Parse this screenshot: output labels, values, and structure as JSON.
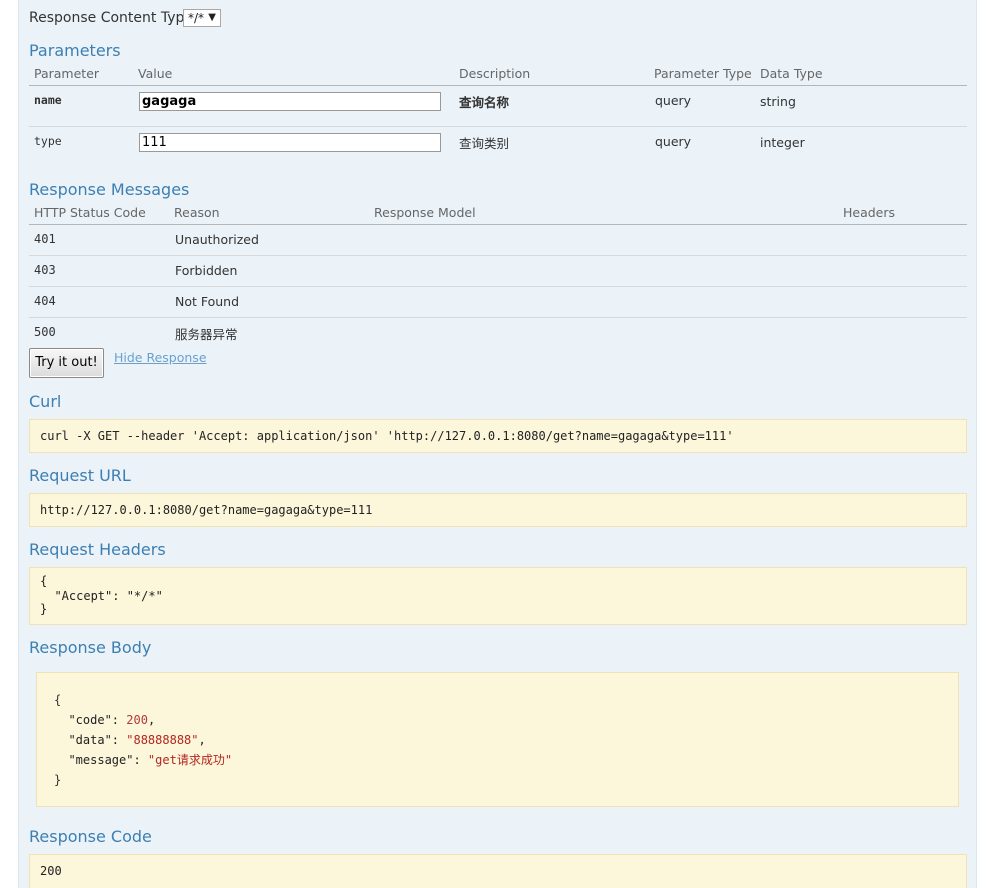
{
  "content_type": {
    "label": "Response Content Type",
    "selected": "*/*"
  },
  "parameters": {
    "title": "Parameters",
    "headers": [
      "Parameter",
      "Value",
      "Description",
      "Parameter Type",
      "Data Type"
    ],
    "rows": [
      {
        "name": "name",
        "value": "gagaga",
        "description": "查询名称",
        "param_type": "query",
        "data_type": "string"
      },
      {
        "name": "type",
        "value": "111",
        "description": "查询类别",
        "param_type": "query",
        "data_type": "integer"
      }
    ]
  },
  "response_messages": {
    "title": "Response Messages",
    "headers": [
      "HTTP Status Code",
      "Reason",
      "Response Model",
      "Headers"
    ],
    "rows": [
      {
        "code": "401",
        "reason": "Unauthorized"
      },
      {
        "code": "403",
        "reason": "Forbidden"
      },
      {
        "code": "404",
        "reason": "Not Found"
      },
      {
        "code": "500",
        "reason": "服务器异常"
      }
    ]
  },
  "actions": {
    "try_label": "Try it out!",
    "hide_label": "Hide Response"
  },
  "curl": {
    "title": "Curl",
    "command": "curl -X GET --header 'Accept: application/json' 'http://127.0.0.1:8080/get?name=gagaga&type=111'"
  },
  "request_url": {
    "title": "Request URL",
    "url": "http://127.0.0.1:8080/get?name=gagaga&type=111"
  },
  "request_headers": {
    "title": "Request Headers",
    "open": "{",
    "line": "  \"Accept\": \"*/*\"",
    "close": "}"
  },
  "response_body": {
    "title": "Response Body",
    "open": "{",
    "code_key": "  \"code\": ",
    "code_val": "200",
    "code_end": ",",
    "data_key": "  \"data\": ",
    "data_val": "\"88888888\"",
    "data_end": ",",
    "msg_key": "  \"message\": ",
    "msg_val": "\"get请求成功\"",
    "close": "}"
  },
  "response_code": {
    "title": "Response Code",
    "value": "200"
  },
  "colors": {
    "heading": "#3c7fb3",
    "panel_bg": "#ebf3f9",
    "code_bg": "#fcf6db",
    "link": "#6a9fce"
  }
}
